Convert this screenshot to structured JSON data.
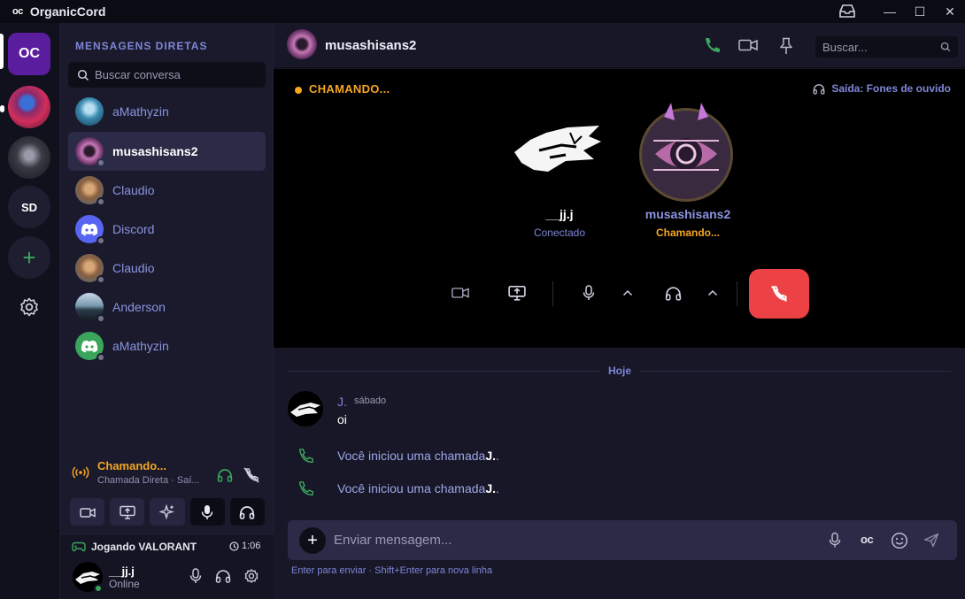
{
  "titlebar": {
    "logo": "oc",
    "title": "OrganicCord"
  },
  "rail": {
    "app_badge": "OC",
    "server_sd": "SD",
    "add": "+"
  },
  "dm": {
    "title": "MENSAGENS DIRETAS",
    "search_placeholder": "Buscar conversa",
    "items": [
      {
        "name": "aMathyzin"
      },
      {
        "name": "musashisans2"
      },
      {
        "name": "Claudio"
      },
      {
        "name": "Discord"
      },
      {
        "name": "Claudio"
      },
      {
        "name": "Anderson"
      },
      {
        "name": "aMathyzin"
      }
    ]
  },
  "call_status": {
    "title": "Chamando...",
    "subtitle": "Chamada Direta · Saí..."
  },
  "user": {
    "activity": "Jogando VALORANT",
    "time": "1:06",
    "name": "__jj.j",
    "status": "Online"
  },
  "header": {
    "name": "musashisans2",
    "search_placeholder": "Buscar..."
  },
  "call": {
    "status": "CHAMANDO...",
    "output": "Saída: Fones de ouvido",
    "participant1_name": "__jj.j",
    "participant1_status": "Conectado",
    "participant2_name": "musashisans2",
    "participant2_status": "Chamando..."
  },
  "chat": {
    "divider": "Hoje",
    "author": "J.",
    "time": "sábado",
    "text": "oi",
    "sys1_prefix": "Você iniciou uma chamada",
    "sys1_name": "J.",
    "sys1_suffix": ".",
    "sys2_prefix": "Você iniciou uma chamada",
    "sys2_name": "J.",
    "sys2_suffix": "."
  },
  "composer": {
    "placeholder": "Enviar mensagem...",
    "hint": "Enter para enviar · Shift+Enter para nova linha"
  },
  "colors": {
    "accent": "#7f86d8",
    "calling": "#f5a623",
    "hangup": "#ed4245",
    "green": "#3ba55c",
    "discord": "#5865f2"
  }
}
